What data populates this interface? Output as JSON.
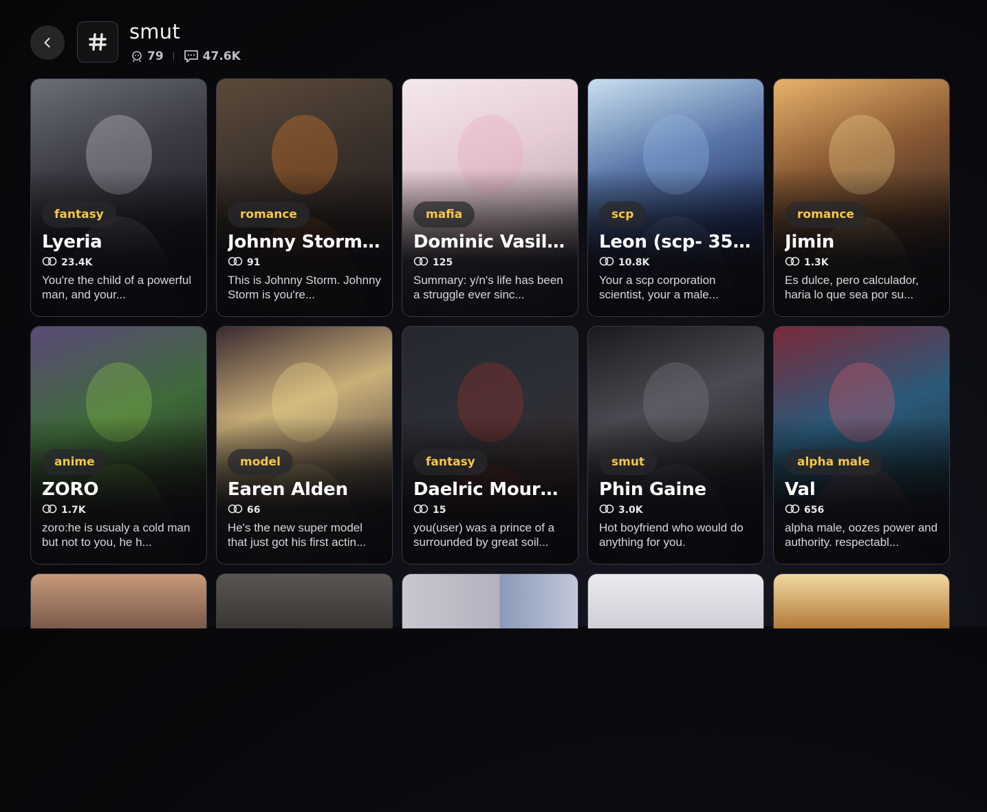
{
  "header": {
    "title": "smut",
    "characters_count": "79",
    "chats_count": "47.6K"
  },
  "cards": [
    {
      "tag": "fantasy",
      "name": "Lyeria",
      "count": "23.4K",
      "desc": "You're the child of a powerful man, and your...",
      "bg": "linear-gradient(160deg,#6b6f78 0%,#3b3c44 35%,#20212a 70%,#15151b 100%)",
      "accent": "#c9c9d2"
    },
    {
      "tag": "romance",
      "name": "Johnny Storm ...",
      "count": "91",
      "desc": "This is Johnny Storm. Johnny Storm is you're...",
      "bg": "linear-gradient(160deg,#5a4a3a 0%,#3a302a 40%,#2a2220 70%,#1a1616 100%)",
      "accent": "#e07a2a"
    },
    {
      "tag": "mafia",
      "name": "Dominic Vasiliev",
      "count": "125",
      "desc": "Summary: y/n's life has been a struggle ever sinc...",
      "bg": "linear-gradient(160deg,#f3e8ec 0%,#e6cdd5 35%,#c8b4b8 60%,#4b3f44 100%)",
      "accent": "#e9a9bb"
    },
    {
      "tag": "scp",
      "name": "Leon (scp- 3578)",
      "count": "10.8K",
      "desc": "Your a scp corporation scientist, your a male...",
      "bg": "linear-gradient(160deg,#c9dff0 0%,#5a77a8 35%,#2a3b6a 65%,#141a2e 100%)",
      "accent": "#8fb7e3"
    },
    {
      "tag": "romance",
      "name": "Jimin",
      "count": "1.3K",
      "desc": "Es dulce, pero calculador, haria lo que sea por su...",
      "bg": "linear-gradient(160deg,#e7b36a 0%,#8a5a34 35%,#4a3326 65%,#1b1512 100%)",
      "accent": "#f0cf8a"
    },
    {
      "tag": "anime",
      "name": "ZORO",
      "count": "1.7K",
      "desc": "zoro:he is usualy a cold man but not to you, he h...",
      "bg": "linear-gradient(160deg,#5a4a78 0%,#3f6a3a 40%,#2b3a26 70%,#16161b 100%)",
      "accent": "#8cc04a"
    },
    {
      "tag": "model",
      "name": "Earen Alden",
      "count": "66",
      "desc": "He's the new super model that just got his first actin...",
      "bg": "linear-gradient(160deg,#3a2a30 0%,#c9b07a 35%,#6a5a4a 65%,#161317 100%)",
      "accent": "#e8d08a"
    },
    {
      "tag": "fantasy",
      "name": "Daelric Mourn...",
      "count": "15",
      "desc": "you(user) was a prince of a surrounded by great soil...",
      "bg": "linear-gradient(160deg,#25282e 0%,#2c2f36 40%,#3a2a2a 70%,#141417 100%)",
      "accent": "#a0302a"
    },
    {
      "tag": "smut",
      "name": "Phin Gaine",
      "count": "3.0K",
      "desc": "Hot boyfriend who would do anything for you.",
      "bg": "linear-gradient(160deg,#1a1a1e 0%,#4a4a52 35%,#2a2a30 65%,#121215 100%)",
      "accent": "#7a7a84"
    },
    {
      "tag": "alpha male",
      "name": "Val",
      "count": "656",
      "desc": "alpha male, oozes power and authority. respectabl...",
      "bg": "linear-gradient(160deg,#7a2a3a 0%,#2a5a7a 40%,#1f3a4a 70%,#121419 100%)",
      "accent": "#e05a6a"
    }
  ],
  "peek_cards": [
    {
      "bg": "linear-gradient(180deg,#c79a7a 0%,#7a5a4a 100%)"
    },
    {
      "bg": "linear-gradient(180deg,#5a5550 0%,#3a3633 100%)"
    },
    {
      "bg": "linear-gradient(90deg,#c9c6d0 0%,#b5b2c0 55%,#8a9ab8 56%,#c2c8d8 100%)"
    },
    {
      "bg": "linear-gradient(180deg,#e9e9ee 0%,#cfd0d8 100%)"
    },
    {
      "bg": "linear-gradient(180deg,#f0d9a0 0%,#b47a3a 100%)"
    }
  ],
  "icons": {
    "back": "chevron-left-icon",
    "tag": "hash-icon",
    "characters": "bot-face-icon",
    "chats": "chat-bubble-icon",
    "card_count": "chat-rings-icon"
  },
  "colors": {
    "badge_text": "#f7c64b",
    "background": "#0b0b10"
  }
}
